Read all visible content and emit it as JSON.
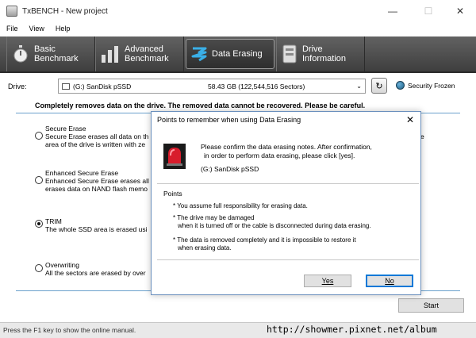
{
  "window": {
    "title": "TxBENCH - New project"
  },
  "menu": [
    "File",
    "View",
    "Help"
  ],
  "toolbar": [
    {
      "l1": "Basic",
      "l2": "Benchmark",
      "icon": "stopwatch-icon"
    },
    {
      "l1": "Advanced",
      "l2": "Benchmark",
      "icon": "bar-chart-icon"
    },
    {
      "l1": "Data Erasing",
      "l2": "",
      "icon": "eraser-icon"
    },
    {
      "l1": "Drive",
      "l2": "Information",
      "icon": "drive-icon"
    }
  ],
  "drive": {
    "label": "Drive:",
    "name": "(G:) SanDisk pSSD",
    "size": "58.43 GB (122,544,516 Sectors)",
    "security": "Security Frozen"
  },
  "warning": "Completely removes data on the drive. The removed data cannot be recovered. Please be careful.",
  "options": [
    {
      "title": "Secure Erase",
      "line1": "Secure Erase erases all data on th",
      "line2": "area of the drive is written with ze",
      "trail": "e",
      "checked": false
    },
    {
      "title": "Enhanced Secure Erase",
      "line1": "Enhanced Secure Erase erases all",
      "line2": "erases data on NAND flash memo",
      "trail": "",
      "checked": false
    },
    {
      "title": "TRIM",
      "line1": "The whole SSD area is erased usi",
      "line2": "",
      "trail": "",
      "checked": true
    },
    {
      "title": "Overwriting",
      "line1": "All the sectors are erased by over",
      "line2": "",
      "trail": "",
      "checked": false
    }
  ],
  "start_label": "Start",
  "status": "Press the F1 key to show the online manual.",
  "watermark": "http://showmer.pixnet.net/album",
  "dialog": {
    "title": "Points to remember when using Data Erasing",
    "msg1": "Please confirm the data erasing notes. After confirmation,",
    "msg2": "in order to perform data erasing, please click [yes].",
    "drive": "(G:) SanDisk pSSD",
    "points_title": "Points",
    "p1": "* You assume full responsibility for erasing data.",
    "p2a": "* The drive may be damaged",
    "p2b": "when it is turned off or the cable is disconnected during data erasing.",
    "p3a": "* The data is removed completely and it is impossible to restore it",
    "p3b": "when erasing data.",
    "yes": "Yes",
    "no": "No"
  }
}
